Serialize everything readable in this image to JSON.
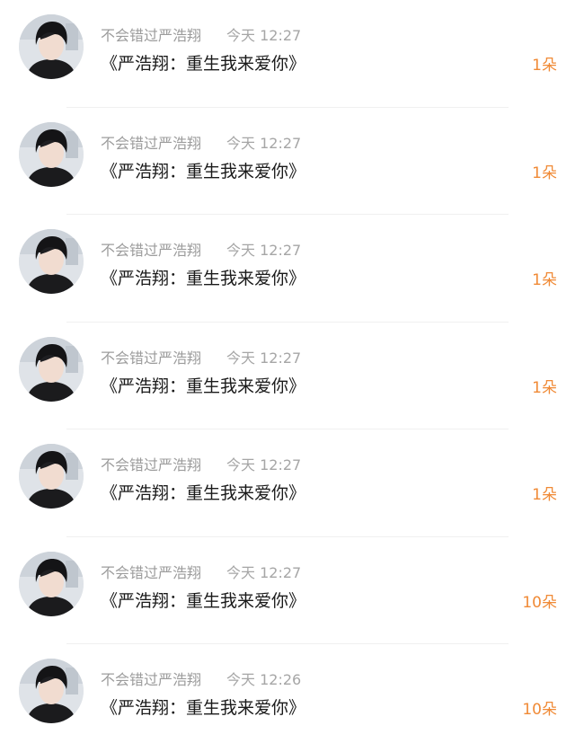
{
  "items": [
    {
      "name": "不会错过严浩翔",
      "time": "今天 12:27",
      "title": "《严浩翔：重生我来爱你》",
      "count": "1朵"
    },
    {
      "name": "不会错过严浩翔",
      "time": "今天 12:27",
      "title": "《严浩翔：重生我来爱你》",
      "count": "1朵"
    },
    {
      "name": "不会错过严浩翔",
      "time": "今天 12:27",
      "title": "《严浩翔：重生我来爱你》",
      "count": "1朵"
    },
    {
      "name": "不会错过严浩翔",
      "time": "今天 12:27",
      "title": "《严浩翔：重生我来爱你》",
      "count": "1朵"
    },
    {
      "name": "不会错过严浩翔",
      "time": "今天 12:27",
      "title": "《严浩翔：重生我来爱你》",
      "count": "1朵"
    },
    {
      "name": "不会错过严浩翔",
      "time": "今天 12:27",
      "title": "《严浩翔：重生我来爱你》",
      "count": "10朵"
    },
    {
      "name": "不会错过严浩翔",
      "time": "今天 12:26",
      "title": "《严浩翔：重生我来爱你》",
      "count": "10朵"
    }
  ],
  "colors": {
    "name": "#9c9c9c",
    "time": "#a6a6a6",
    "title": "#1a1a1a",
    "count": "#f08a36",
    "divider": "#f0f0f0"
  },
  "icons": {
    "avatar": "user-avatar-photo"
  }
}
